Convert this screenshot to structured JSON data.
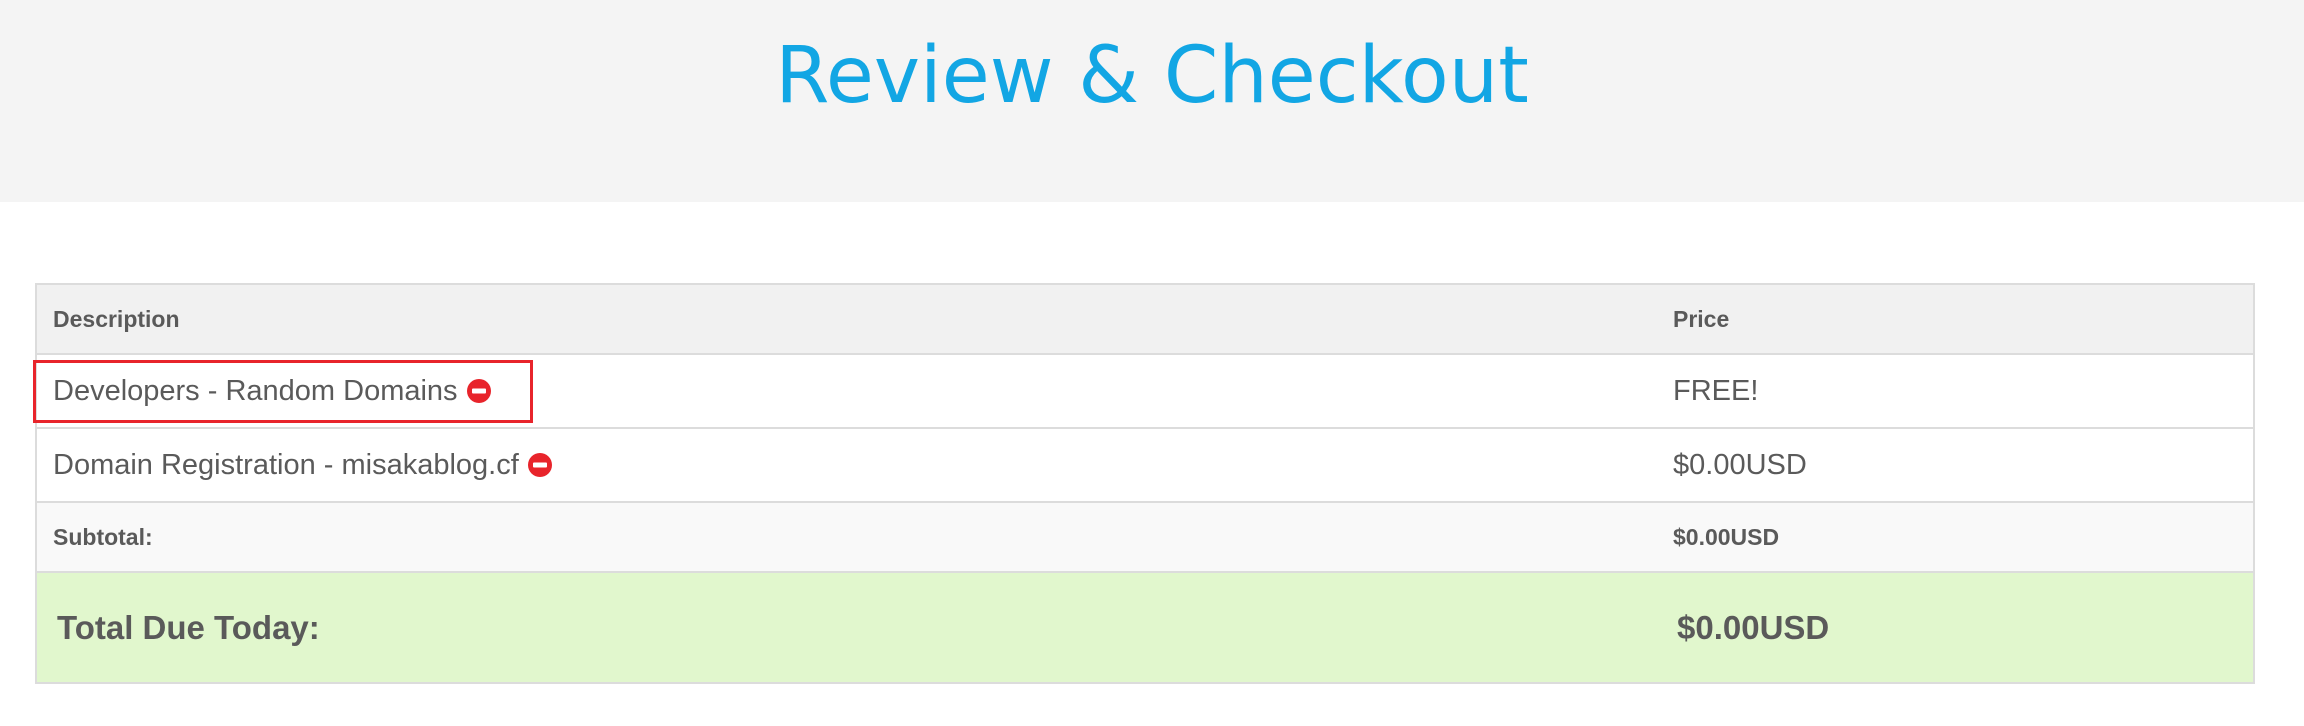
{
  "header": {
    "title": "Review & Checkout"
  },
  "table": {
    "columns": {
      "description": "Description",
      "price": "Price"
    },
    "items": [
      {
        "description": "Developers - Random Domains",
        "price": "FREE!",
        "remove_icon": "remove-circle-icon",
        "highlighted": true
      },
      {
        "description": "Domain Registration - misakablog.cf",
        "price": "$0.00USD",
        "remove_icon": "remove-circle-icon",
        "highlighted": false
      }
    ],
    "subtotal": {
      "label": "Subtotal:",
      "value": "$0.00USD"
    },
    "total": {
      "label": "Total Due Today:",
      "value": "$0.00USD"
    }
  },
  "colors": {
    "title": "#12a6e4",
    "remove_icon": "#e8242b",
    "highlight_border": "#e8242b",
    "total_row_bg": "#e1f7cd",
    "header_bg": "#f4f4f4"
  }
}
